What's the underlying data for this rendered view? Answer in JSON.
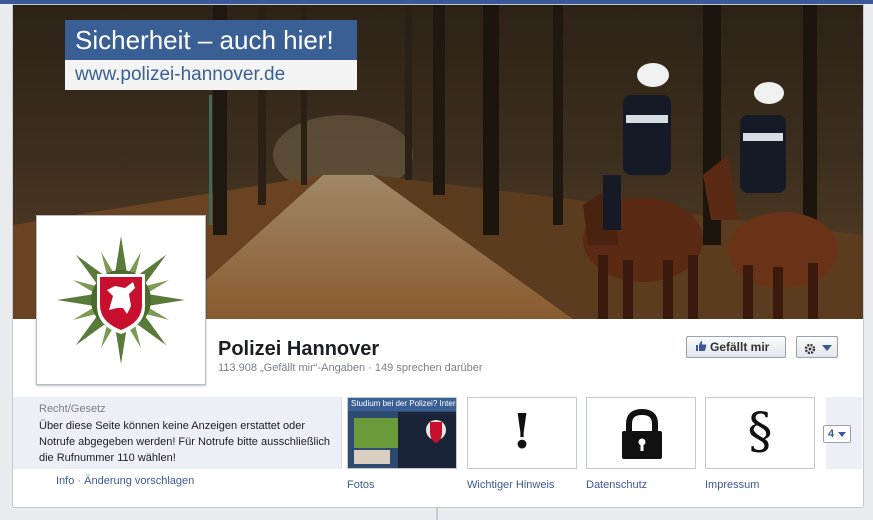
{
  "cover": {
    "banner_title": "Sicherheit – auch hier!",
    "banner_url": "www.polizei-hannover.de"
  },
  "page": {
    "name": "Polizei Hannover",
    "stats": "113.908 „Gefällt mir“-Angaben · 149 sprechen darüber"
  },
  "actions": {
    "like_label": "Gefällt mir",
    "like_icon": "thumbs-up-icon",
    "settings_icon": "gear-icon"
  },
  "about": {
    "category": "Recht/Gesetz",
    "text": "Über diese Seite können keine Anzeigen erstattet oder Notrufe abgegeben werden! Für Notrufe bitte ausschließlich die Rufnummer 110 wählen!",
    "links": [
      "Info",
      "Änderung vorschlagen"
    ]
  },
  "apps": [
    {
      "label": "Fotos",
      "thumb_caption": "Studium bei der Polizei? Interessi"
    },
    {
      "label": "Wichtiger Hinweis",
      "glyph": "!"
    },
    {
      "label": "Datenschutz",
      "icon": "lock-icon"
    },
    {
      "label": "Impressum",
      "glyph": "§"
    }
  ],
  "more_apps": "4",
  "colors": {
    "link": "#3b5998",
    "banner_blue": "#3a5f94",
    "crest_red": "#c8102e",
    "star_green": "#5a7a3a"
  }
}
